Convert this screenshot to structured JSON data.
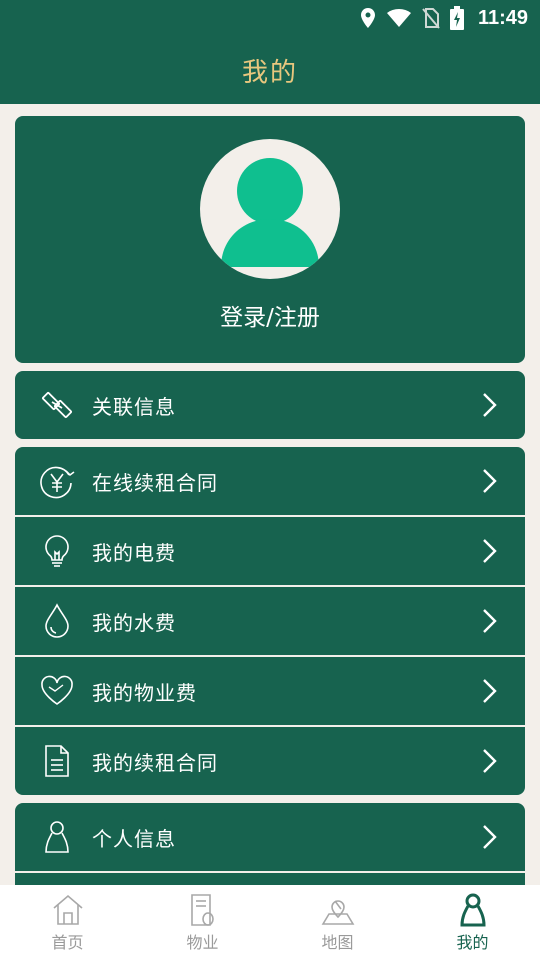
{
  "status_bar": {
    "time": "11:49"
  },
  "header": {
    "title": "我的"
  },
  "profile": {
    "login_label": "登录/注册"
  },
  "menu_groups": [
    {
      "items": [
        {
          "label": "关联信息",
          "icon": "link-icon"
        }
      ]
    },
    {
      "items": [
        {
          "label": "在线续租合同",
          "icon": "yuan-renew-icon"
        },
        {
          "label": "我的电费",
          "icon": "lightbulb-icon"
        },
        {
          "label": "我的水费",
          "icon": "water-drop-icon"
        },
        {
          "label": "我的物业费",
          "icon": "heart-icon"
        },
        {
          "label": "我的续租合同",
          "icon": "document-icon"
        }
      ]
    },
    {
      "items": [
        {
          "label": "个人信息",
          "icon": "person-icon"
        }
      ]
    }
  ],
  "bottom_nav": {
    "tabs": [
      {
        "label": "首页",
        "icon": "home-icon"
      },
      {
        "label": "物业",
        "icon": "property-icon"
      },
      {
        "label": "地图",
        "icon": "map-icon"
      },
      {
        "label": "我的",
        "icon": "profile-icon",
        "active": true
      }
    ]
  },
  "colors": {
    "primary": "#17634f",
    "title_gold": "#e8c77e",
    "avatar_green": "#0fbf8f",
    "background": "#f3efea",
    "inactive_gray": "#9a9a9a"
  }
}
